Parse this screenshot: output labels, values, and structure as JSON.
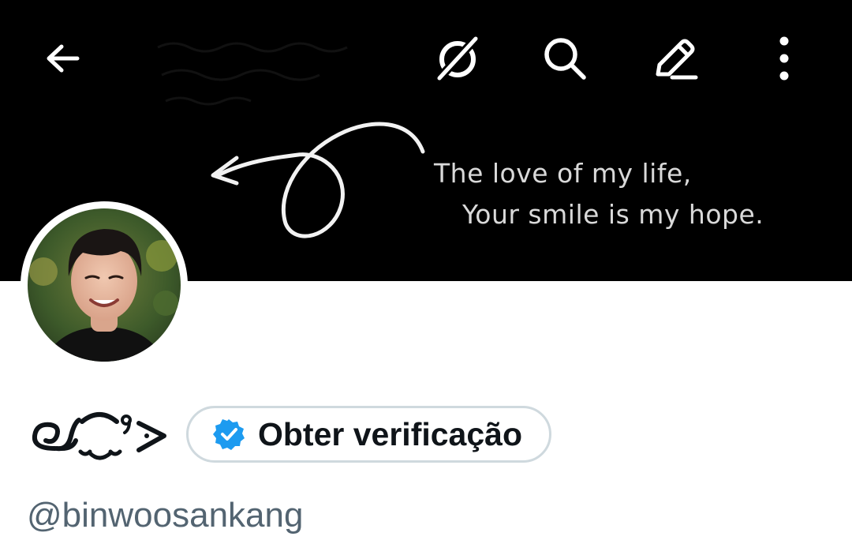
{
  "banner": {
    "line1": "The love of my life,",
    "line2": "Your smile is my hope."
  },
  "toolbar": {
    "back_icon": "arrow-left-icon",
    "grok_icon": "grok-icon",
    "search_icon": "search-icon",
    "edit_icon": "edit-pencil-icon",
    "more_icon": "more-vertical-icon"
  },
  "profile": {
    "avatar_icon": "profile-avatar-photo",
    "display_name_glyph": "ʚ⁀ˀ>",
    "verify_button_label": "Obter verificação",
    "verify_badge_icon": "verified-badge-icon",
    "handle": "@binwoosankang"
  },
  "colors": {
    "banner_bg": "#000000",
    "verify_blue": "#1d9bf0",
    "handle_gray": "#536471",
    "pill_border": "#cfd9de",
    "text_primary": "#0f1419"
  }
}
